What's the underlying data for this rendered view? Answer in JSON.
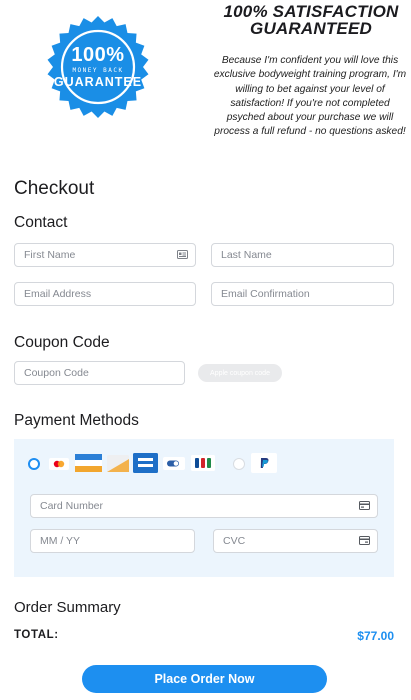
{
  "guarantee": {
    "badge_percent": "100%",
    "badge_line1": "MONEY BACK",
    "badge_line2": "GUARANTEE",
    "title_line1": "100% SATISFACTION",
    "title_line2": "GUARANTEED",
    "description": "Because I'm confident you will love this exclusive bodyweight training program, I'm willing to bet against your level of satisfaction! If you're not completed psyched about your purchase we will process a full refund - no questions asked!",
    "badge_color": "#1a8ee6"
  },
  "checkout": {
    "title": "Checkout",
    "contact": {
      "heading": "Contact",
      "first_name_placeholder": "First Name",
      "last_name_placeholder": "Last Name",
      "email_placeholder": "Email Address",
      "email_confirm_placeholder": "Email Confirmation"
    },
    "coupon": {
      "heading": "Coupon Code",
      "placeholder": "Coupon Code",
      "apple_button_label": "Apple coupon code"
    },
    "payment": {
      "heading": "Payment Methods",
      "methods_icons": [
        "mastercard-icon",
        "card-stripe-icon",
        "card-orange-icon",
        "amex-icon",
        "toggle-card-icon",
        "jcb-icon",
        "paypal-icon"
      ],
      "selected_method": "card",
      "card_number_placeholder": "Card Number",
      "expiry_placeholder": "MM / YY",
      "cvc_placeholder": "CVC"
    },
    "summary": {
      "heading": "Order Summary",
      "total_label": "TOTAL:",
      "total_value": "$77.00"
    },
    "place_order_label": "Place Order Now"
  },
  "colors": {
    "accent": "#1d8ff0",
    "payment_panel": "#ecf5fd"
  }
}
